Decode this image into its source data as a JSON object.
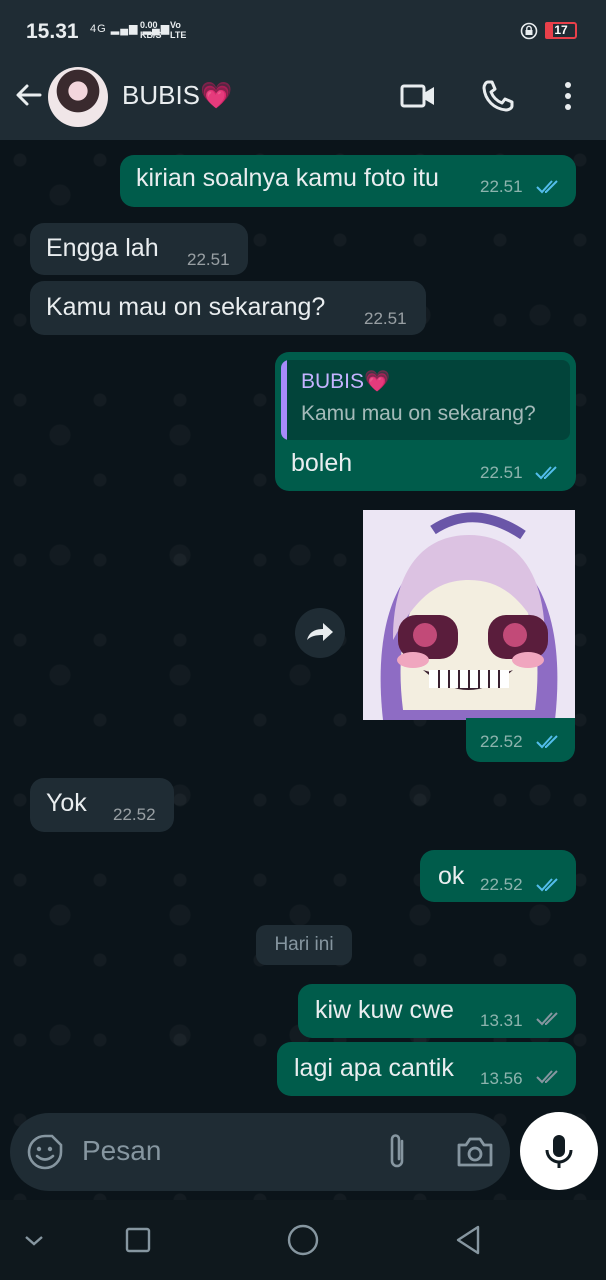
{
  "status_bar": {
    "time": "15.31",
    "network": "4G",
    "speed_value": "0.00",
    "speed_unit": "KB/S",
    "volte": "Vo",
    "lte": "LTE",
    "battery": "17"
  },
  "header": {
    "contact_name": "BUBIS💗"
  },
  "messages": [
    {
      "text": "kirian soalnya kamu foto itu",
      "time": "22.51"
    },
    {
      "text": "Engga lah",
      "time": "22.51"
    },
    {
      "text": "Kamu mau on sekarang?",
      "time": "22.51"
    },
    {
      "quote_name": "BUBIS💗",
      "quote_text": "Kamu mau on sekarang?",
      "text": "boleh",
      "time": "22.51"
    },
    {
      "time": "22.52"
    },
    {
      "text": "Yok",
      "time": "22.52"
    },
    {
      "text": "ok",
      "time": "22.52"
    },
    {
      "text": "kiw kuw cwe",
      "time": "13.31"
    },
    {
      "text": "lagi apa cantik",
      "time": "13.56"
    }
  ],
  "date_divider": "Hari ini",
  "input": {
    "placeholder": "Pesan"
  },
  "colors": {
    "outgoing_bubble": "#005c4b",
    "incoming_bubble": "#1f2c34",
    "read_ticks": "#53bdeb",
    "delivered_ticks": "#8696a0",
    "background": "#0b141a"
  }
}
